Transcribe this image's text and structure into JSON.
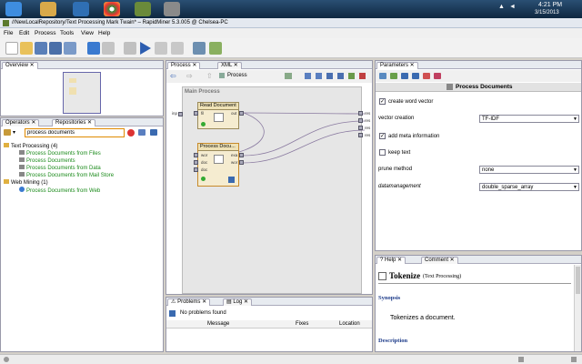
{
  "taskbar": {
    "clock_time": "4:21 PM",
    "clock_date": "3/15/2013"
  },
  "window": {
    "title": "//NewLocalRepository/Text Processing Mark Twain* – RapidMiner 5.3.005 @ Chelsea-PC"
  },
  "menu": [
    "File",
    "Edit",
    "Process",
    "Tools",
    "View",
    "Help"
  ],
  "left": {
    "overview_tab": "Overview",
    "operators_tab": "Operators",
    "repositories_tab": "Repositories",
    "search_value": "process documents",
    "tree": [
      {
        "label": "Text Processing (4)",
        "kind": "folder"
      },
      {
        "label": "Process Documents from Files",
        "kind": "leaf"
      },
      {
        "label": "Process Documents",
        "kind": "leaf"
      },
      {
        "label": "Process Documents from Data",
        "kind": "leaf"
      },
      {
        "label": "Process Documents from Mail Store",
        "kind": "leaf"
      },
      {
        "label": "Web Mining (1)",
        "kind": "folder"
      },
      {
        "label": "Process Documents from Web",
        "kind": "leaf"
      }
    ]
  },
  "center": {
    "process_tab": "Process",
    "xml_tab": "XML",
    "breadcrumb": "Process",
    "canvas_title": "Main Process",
    "inp_label": "inp",
    "res_labels": [
      "res",
      "res",
      "res",
      "res"
    ],
    "op1": {
      "name": "Read Document",
      "port_in": "fil",
      "port_out": "out"
    },
    "op2": {
      "name": "Process Docu...",
      "ports_in": [
        "wor",
        "doc",
        "doc"
      ],
      "ports_out": [
        "exa",
        "wor"
      ]
    },
    "problems_tab": "Problems",
    "log_tab": "Log",
    "problems_status": "No problems found",
    "problems_cols": [
      "Message",
      "Fixes",
      "Location"
    ]
  },
  "right": {
    "parameters_tab": "Parameters",
    "header": "Process Documents",
    "create_word_vector": "create word vector",
    "vector_creation_label": "vector creation",
    "vector_creation_value": "TF-IDF",
    "add_meta_information": "add meta information",
    "keep_text": "keep text",
    "prune_method_label": "prune method",
    "prune_method_value": "none",
    "datamanagement_label": "datamanagement",
    "datamanagement_value": "double_sparse_array",
    "help_tab": "Help",
    "comment_tab": "Comment",
    "help_title": "Tokenize",
    "help_subtitle": "(Text Processing)",
    "synopsis_label": "Synopsis",
    "synopsis_text": "Tokenizes a document.",
    "description_label": "Description"
  }
}
